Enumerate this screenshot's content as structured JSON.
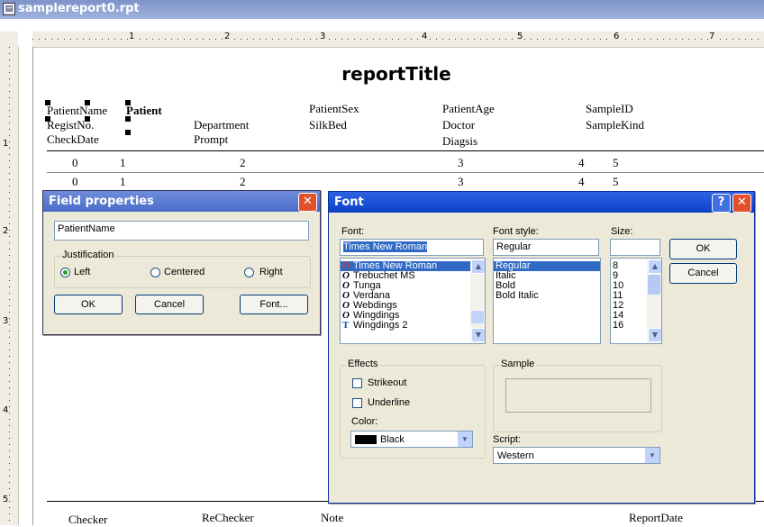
{
  "window": {
    "title": "samplereport0.rpt"
  },
  "ruler": {
    "h_numbers": [
      "1",
      "2",
      "3",
      "4",
      "5",
      "6",
      "7"
    ],
    "v_numbers": [
      "1",
      "2",
      "3",
      "4",
      "5"
    ]
  },
  "report": {
    "title": "reportTitle",
    "header_fields": {
      "patient_name": "PatientName",
      "patient_sel": "Patient",
      "patient_sex": "PatientSex",
      "patient_age": "PatientAge",
      "sample_id": "SampleID",
      "regist_no": "RegistNo.",
      "department": "Department",
      "silk_bed": "SilkBed",
      "doctor": "Doctor",
      "sample_kind": "SampleKind",
      "check_date": "CheckDate",
      "prompt": "Prompt",
      "diagsis": "Diagsis"
    },
    "detail_rows": [
      [
        "0",
        "1",
        "2",
        "3",
        "4",
        "5"
      ],
      [
        "0",
        "1",
        "2",
        "3",
        "4",
        "5"
      ]
    ],
    "footer": {
      "checker": "Checker",
      "rechecker": "ReChecker",
      "note": "Note",
      "report_date": "ReportDate"
    }
  },
  "field_dialog": {
    "title": "Field properties",
    "field_value": "PatientName",
    "justification_label": "Justification",
    "options": [
      "Left",
      "Centered",
      "Right"
    ],
    "selected": "Left",
    "ok": "OK",
    "cancel": "Cancel",
    "font_btn": "Font..."
  },
  "font_dialog": {
    "title": "Font",
    "font_label": "Font:",
    "font_value": "Times New Roman",
    "fonts": [
      "Times New Roman",
      "Trebuchet MS",
      "Tunga",
      "Verdana",
      "Webdings",
      "Wingdings",
      "Wingdings 2"
    ],
    "style_label": "Font style:",
    "style_value": "Regular",
    "styles": [
      "Regular",
      "Italic",
      "Bold",
      "Bold Italic"
    ],
    "size_label": "Size:",
    "size_value": "",
    "sizes": [
      "8",
      "9",
      "10",
      "11",
      "12",
      "14",
      "16"
    ],
    "ok": "OK",
    "cancel": "Cancel",
    "effects_label": "Effects",
    "strikeout": "Strikeout",
    "underline": "Underline",
    "color_label": "Color:",
    "color_value": "Black",
    "sample_label": "Sample",
    "script_label": "Script:",
    "script_value": "Western"
  }
}
